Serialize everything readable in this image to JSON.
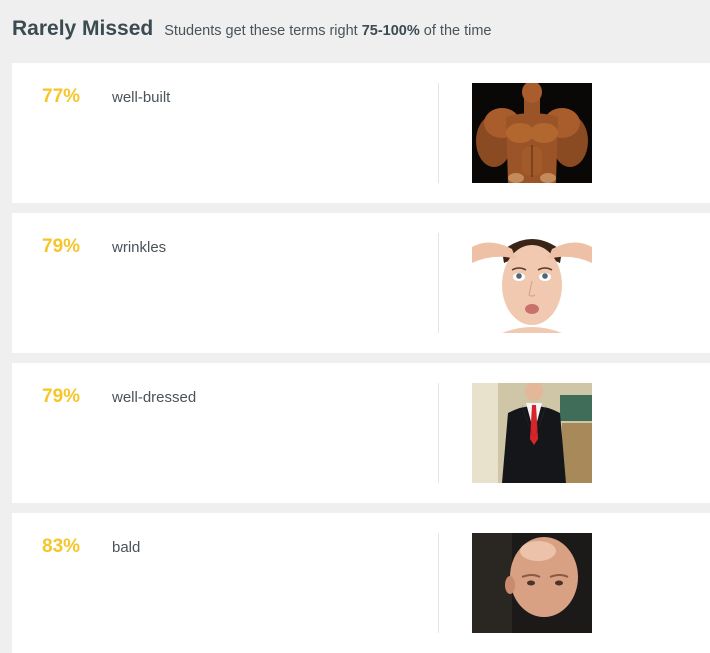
{
  "header": {
    "title": "Rarely Missed",
    "subtitle_pre": "Students get these terms right ",
    "subtitle_pct": "75-100%",
    "subtitle_post": " of the time"
  },
  "terms": [
    {
      "percent": "77%",
      "term": "well-built",
      "image": "muscular-man-image"
    },
    {
      "percent": "79%",
      "term": "wrinkles",
      "image": "woman-forehead-image"
    },
    {
      "percent": "79%",
      "term": "well-dressed",
      "image": "man-in-suit-image"
    },
    {
      "percent": "83%",
      "term": "bald",
      "image": "bald-man-image"
    }
  ],
  "colors": {
    "accent_percent": "#f6c52a",
    "title": "#3c4a52",
    "background": "#efefef",
    "card": "#ffffff"
  }
}
